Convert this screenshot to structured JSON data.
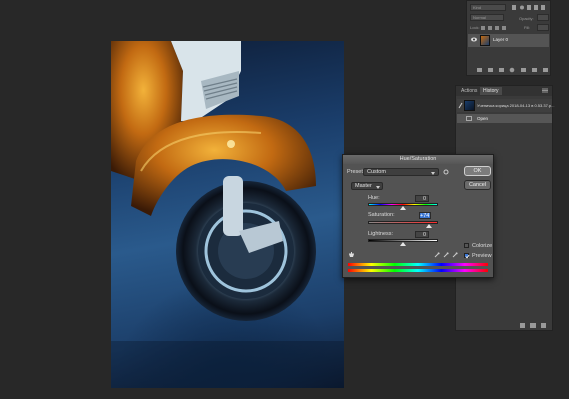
{
  "layers_panel": {
    "search_placeholder": "Kind",
    "mode_label": "Normal",
    "opacity_label": "Opacity:",
    "lock_label": "Lock:",
    "fill_label": "Fill:",
    "layer_name": "Layer 0"
  },
  "history_panel": {
    "tabs": [
      "Actions",
      "History"
    ],
    "active_tab": "History",
    "snapshot_label": "Ученичка корица 2018-04-13 в 0.53.37.p...",
    "state_label": "Open"
  },
  "dialog": {
    "title": "Hue/Saturation",
    "preset_label": "Preset:",
    "preset_value": "Custom",
    "channel_value": "Master",
    "ok_label": "OK",
    "cancel_label": "Cancel",
    "hue": {
      "label": "Hue:",
      "value": "0",
      "fraction": 0.5
    },
    "saturation": {
      "label": "Saturation:",
      "value": "+74",
      "fraction": 0.87
    },
    "lightness": {
      "label": "Lightness:",
      "value": "0",
      "fraction": 0.5
    },
    "colorize_label": "Colorize",
    "colorize_checked": false,
    "preview_label": "Preview",
    "preview_checked": true
  },
  "colors": {
    "accent": "#3c77d2",
    "rust": "#c26a12",
    "background": "#282828"
  }
}
